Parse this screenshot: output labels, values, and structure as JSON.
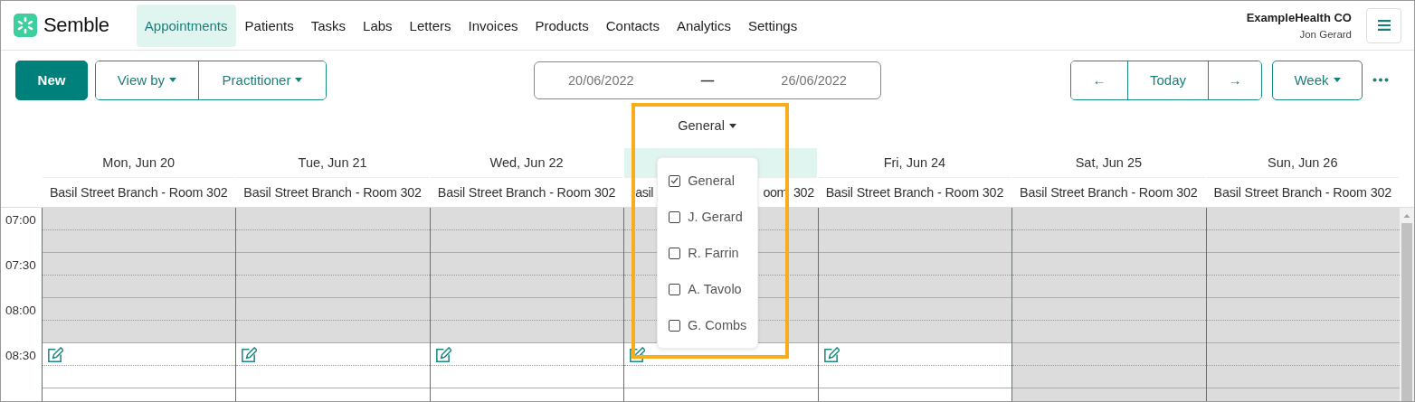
{
  "brand": {
    "name": "Semble"
  },
  "nav": [
    {
      "label": "Appointments",
      "selected": true
    },
    {
      "label": "Patients",
      "selected": false
    },
    {
      "label": "Tasks",
      "selected": false
    },
    {
      "label": "Labs",
      "selected": false
    },
    {
      "label": "Letters",
      "selected": false
    },
    {
      "label": "Invoices",
      "selected": false
    },
    {
      "label": "Products",
      "selected": false
    },
    {
      "label": "Contacts",
      "selected": false
    },
    {
      "label": "Analytics",
      "selected": false
    },
    {
      "label": "Settings",
      "selected": false
    }
  ],
  "account": {
    "org": "ExampleHealth CO",
    "user": "Jon Gerard"
  },
  "toolbar": {
    "new": "New",
    "view_by": "View by",
    "practitioner": "Practitioner",
    "date_from": "20/06/2022",
    "date_separator": "—",
    "date_to": "26/06/2022",
    "prev": "←",
    "today": "Today",
    "next": "→",
    "range": "Week"
  },
  "filter": {
    "label": "General",
    "open": true,
    "options": [
      {
        "label": "General",
        "checked": true
      },
      {
        "label": "J. Gerard",
        "checked": false
      },
      {
        "label": "R. Farrin",
        "checked": false
      },
      {
        "label": "A. Tavolo",
        "checked": false
      },
      {
        "label": "G. Combs",
        "checked": false
      }
    ]
  },
  "times": [
    "07:00",
    "07:30",
    "08:00",
    "08:30"
  ],
  "days": [
    {
      "label": "Mon, Jun 20",
      "room": "Basil Street Branch - Room 302",
      "today": false,
      "slots": [
        {
          "available": false,
          "edit": false
        },
        {
          "available": false,
          "edit": false
        },
        {
          "available": false,
          "edit": false
        },
        {
          "available": true,
          "edit": true
        }
      ]
    },
    {
      "label": "Tue, Jun 21",
      "room": "Basil Street Branch - Room 302",
      "today": false,
      "slots": [
        {
          "available": false,
          "edit": false
        },
        {
          "available": false,
          "edit": false
        },
        {
          "available": false,
          "edit": false
        },
        {
          "available": true,
          "edit": true
        }
      ]
    },
    {
      "label": "Wed, Jun 22",
      "room": "Basil Street Branch - Room 302",
      "today": false,
      "slots": [
        {
          "available": false,
          "edit": false
        },
        {
          "available": false,
          "edit": false
        },
        {
          "available": false,
          "edit": false
        },
        {
          "available": true,
          "edit": true
        }
      ]
    },
    {
      "room_parts": [
        "asil",
        "oom",
        "302"
      ],
      "today": true,
      "slots": [
        {
          "available": false,
          "edit": false
        },
        {
          "available": false,
          "edit": false
        },
        {
          "available": false,
          "edit": false
        },
        {
          "available": true,
          "edit": true
        }
      ]
    },
    {
      "label": "Fri, Jun 24",
      "room": "Basil Street Branch - Room 302",
      "today": false,
      "slots": [
        {
          "available": false,
          "edit": false
        },
        {
          "available": false,
          "edit": false
        },
        {
          "available": false,
          "edit": false
        },
        {
          "available": true,
          "edit": true
        }
      ]
    },
    {
      "label": "Sat, Jun 25",
      "room": "Basil Street Branch - Room 302",
      "today": false,
      "slots": [
        {
          "available": false,
          "edit": false
        },
        {
          "available": false,
          "edit": false
        },
        {
          "available": false,
          "edit": false
        },
        {
          "available": false,
          "edit": false
        },
        {
          "available": false,
          "edit": false
        }
      ]
    },
    {
      "label": "Sun, Jun 26",
      "room": "Basil Street Branch - Room 302",
      "today": false,
      "slots": [
        {
          "available": false,
          "edit": false
        },
        {
          "available": false,
          "edit": false
        },
        {
          "available": false,
          "edit": false
        },
        {
          "available": false,
          "edit": false
        },
        {
          "available": false,
          "edit": false
        }
      ]
    }
  ]
}
